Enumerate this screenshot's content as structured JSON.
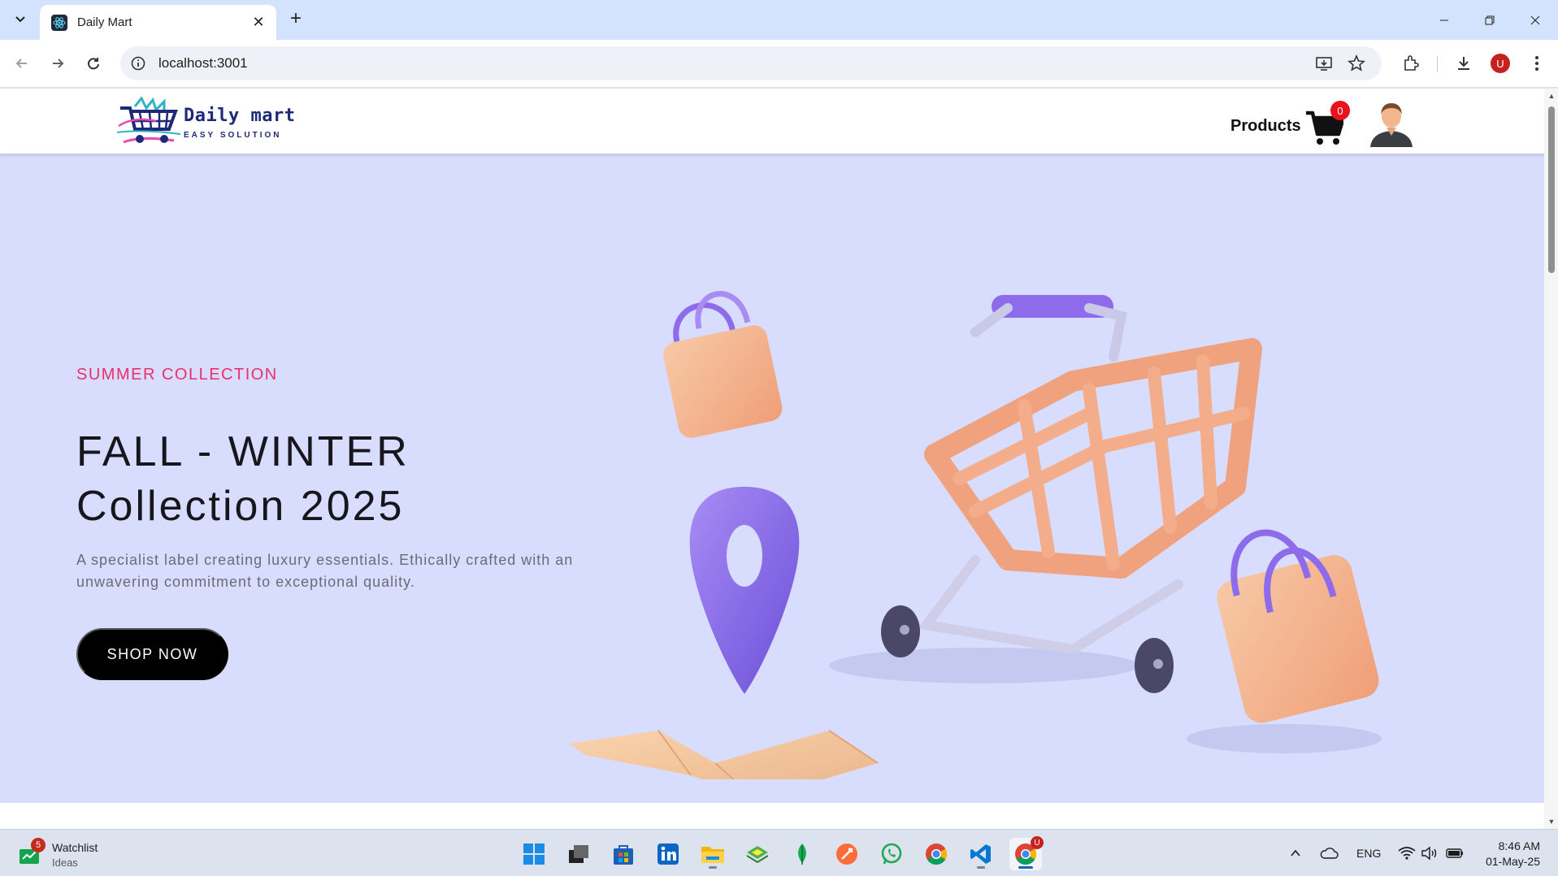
{
  "browser": {
    "tab_title": "Daily Mart",
    "url": "localhost:3001",
    "profile_initial": "U"
  },
  "site": {
    "logo_name": "Daily mart",
    "logo_tagline": "EASY SOLUTION",
    "nav_products": "Products",
    "cart_count": "0"
  },
  "hero": {
    "eyebrow": "SUMMER COLLECTION",
    "title_line1": "FALL - WINTER",
    "title_line2": "Collection 2025",
    "description": "A specialist label creating luxury essentials. Ethically crafted with an unwavering commitment to exceptional quality.",
    "cta": "SHOP NOW"
  },
  "taskbar": {
    "widget_title": "Watchlist",
    "widget_subtitle": "Ideas",
    "widget_badge": "5",
    "language": "ENG",
    "time": "8:46 AM",
    "date": "01-May-25",
    "chrome_badge": "U"
  },
  "colors": {
    "hero_bg": "#d8dcfd",
    "eyebrow": "#e9306b",
    "cart_badge": "#e8131b",
    "tab_strip": "#d3e3fd"
  },
  "icons": [
    "dropdown-icon",
    "react-favicon",
    "close-icon",
    "plus-icon",
    "minimize-icon",
    "restore-icon",
    "window-close-icon",
    "back-icon",
    "forward-icon",
    "reload-icon",
    "info-icon",
    "install-icon",
    "star-icon",
    "extensions-icon",
    "download-icon",
    "more-icon",
    "cart-icon",
    "user-avatar-icon",
    "windows-icon",
    "wifi-icon",
    "volume-icon",
    "battery-icon",
    "cloud-icon",
    "chevron-up-icon"
  ]
}
